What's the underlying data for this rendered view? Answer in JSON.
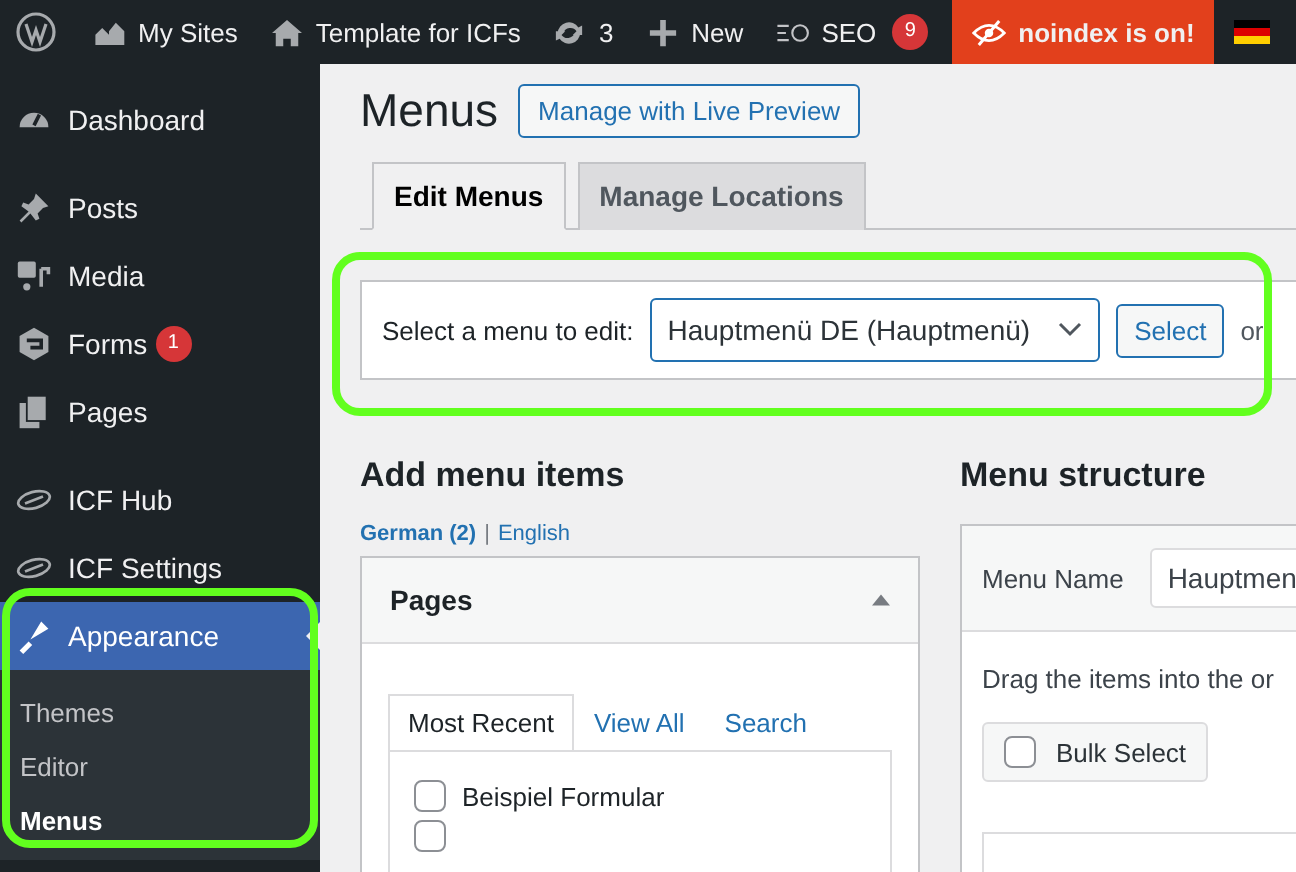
{
  "admin_bar": {
    "my_sites": "My Sites",
    "site": "Template for ICFs",
    "updates": "3",
    "new": "New",
    "seo": "SEO",
    "seo_count": "9",
    "noindex": "noindex is on!"
  },
  "sidebar": {
    "groups": [
      {
        "items": [
          {
            "label": "Dashboard",
            "selected": false
          }
        ]
      },
      {
        "items": [
          {
            "label": "Posts",
            "selected": false
          },
          {
            "label": "Media",
            "selected": false
          },
          {
            "label": "Forms",
            "badge": "1",
            "selected": false
          },
          {
            "label": "Pages",
            "selected": false
          }
        ]
      },
      {
        "items": [
          {
            "label": "ICF Hub",
            "selected": false
          },
          {
            "label": "ICF Settings",
            "selected": false
          },
          {
            "label": "Appearance",
            "selected": true,
            "children": [
              {
                "label": "Themes",
                "selected": false
              },
              {
                "label": "Editor",
                "selected": false
              },
              {
                "label": "Menus",
                "selected": true
              }
            ]
          }
        ]
      }
    ]
  },
  "page": {
    "title": "Menus",
    "live_preview_button": "Manage with Live Preview"
  },
  "tabs": [
    {
      "label": "Edit Menus",
      "selected": true
    },
    {
      "label": "Manage Locations",
      "selected": false
    }
  ],
  "menu_select": {
    "label": "Select a menu to edit:",
    "value": "Hauptmenü DE (Hauptmenü)",
    "button": "Select",
    "trailing": "or"
  },
  "add_menu_items": {
    "title": "Add menu items",
    "languages": [
      {
        "label": "German (2)",
        "selected": true
      },
      {
        "label": "English",
        "selected": false
      }
    ],
    "language_separator": "|",
    "panel": {
      "title": "Pages",
      "expanded": true,
      "tabs": [
        {
          "label": "Most Recent",
          "selected": true
        },
        {
          "label": "View All",
          "selected": false
        },
        {
          "label": "Search",
          "selected": false
        }
      ],
      "items": [
        {
          "label": "Beispiel Formular",
          "checked": false
        },
        {
          "checked": false
        }
      ]
    }
  },
  "menu_structure": {
    "title": "Menu structure",
    "name_label": "Menu Name",
    "name_value": "Hauptmen",
    "hint": "Drag the items into the or",
    "bulk_select": {
      "label": "Bulk Select",
      "checked": false
    }
  }
}
